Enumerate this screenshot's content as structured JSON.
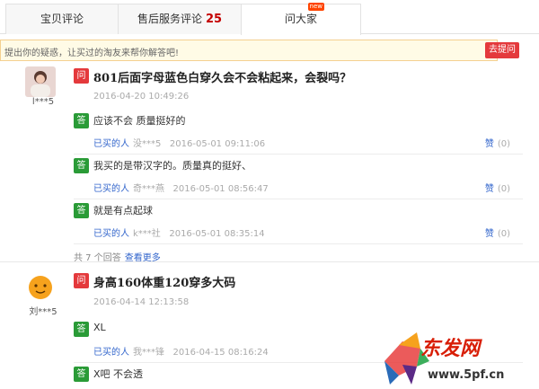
{
  "tabs": [
    {
      "label": "宝贝评论",
      "count": ""
    },
    {
      "label": "售后服务评论",
      "count": "25"
    },
    {
      "label": "问大家",
      "count": "",
      "badge": "new"
    }
  ],
  "ask": {
    "placeholder": "提出你的疑惑，让买过的淘友来帮你解答吧!",
    "button": "去提问"
  },
  "questions": [
    {
      "user": "l***5",
      "question": "801后面字母蓝色白穿久会不会粘起来，会裂吗？",
      "time": "2016-04-20 10:49:26",
      "answers": [
        {
          "text": "应该不会 质量挺好的",
          "buyer": "已买的人",
          "user": "没***5",
          "time": "2016-05-01 09:11:06",
          "like": "赞",
          "count": "(0)"
        },
        {
          "text": "我买的是带汉字的。质量真的挺好、",
          "buyer": "已买的人",
          "user": "奇***燕",
          "time": "2016-05-01 08:56:47",
          "like": "赞",
          "count": "(0)"
        },
        {
          "text": "就是有点起球",
          "buyer": "已买的人",
          "user": "k***社",
          "time": "2016-05-01 08:35:14",
          "like": "赞",
          "count": "(0)"
        }
      ],
      "total": "共 7 个回答",
      "more": "查看更多"
    },
    {
      "user": "刘***5",
      "question": "身高160体重120穿多大码",
      "time": "2016-04-14 12:13:58",
      "answers": [
        {
          "text": "XL",
          "buyer": "已买的人",
          "user": "我***锋",
          "time": "2016-04-15 08:16:24",
          "like": "赞",
          "count": "(0)"
        },
        {
          "text": "X吧 不会透",
          "buyer": "",
          "user": "",
          "time": "",
          "like": "",
          "count": ""
        }
      ]
    }
  ],
  "labels": {
    "q": "问",
    "a": "答"
  },
  "watermark": {
    "logo": "东发网",
    "url": "www.5pf.cn"
  },
  "colors": {
    "question_tag": "#e4393c",
    "answer_tag": "#2a9b37",
    "link": "#3366cc",
    "accent": "#c40000"
  }
}
